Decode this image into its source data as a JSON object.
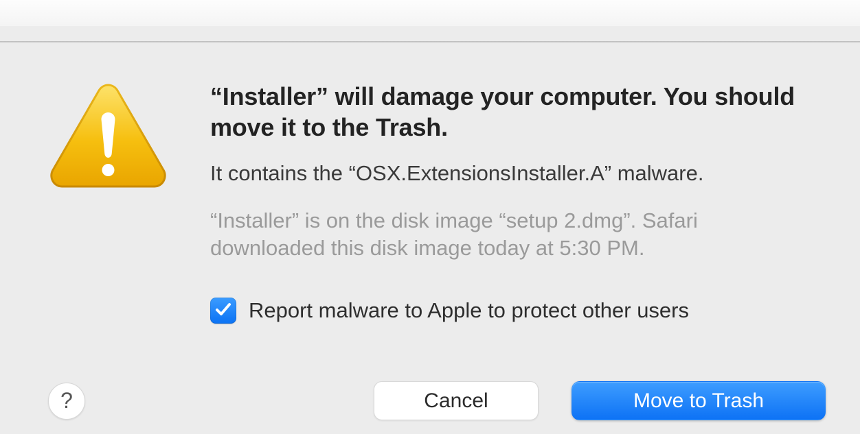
{
  "dialog": {
    "title": "“Installer” will damage your computer. You should move it to the Trash.",
    "subtitle": "It contains the “OSX.ExtensionsInstaller.A” malware.",
    "detail": "“Installer” is on the disk image “setup 2.dmg”. Safari downloaded this disk image today at 5:30 PM.",
    "report_checkbox": {
      "checked": true,
      "label": "Report malware to Apple to protect other users"
    },
    "buttons": {
      "help": "?",
      "cancel": "Cancel",
      "primary": "Move to Trash"
    },
    "icon": "warning-triangle",
    "colors": {
      "accent": "#1476f6",
      "warning": "#f3b300"
    }
  }
}
